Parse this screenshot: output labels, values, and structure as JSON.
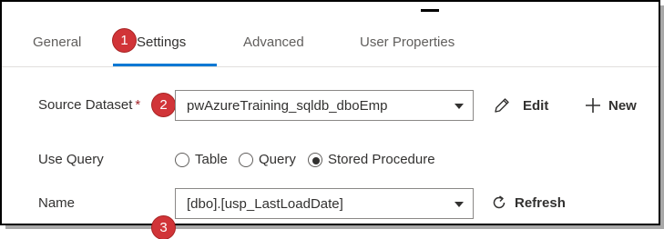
{
  "tabs": [
    {
      "label": "General"
    },
    {
      "label": "Settings"
    },
    {
      "label": "Advanced"
    },
    {
      "label": "User Properties"
    }
  ],
  "badges": [
    "1",
    "2",
    "3"
  ],
  "source_dataset": {
    "label": "Source Dataset",
    "required_marker": "*",
    "value": "pwAzureTraining_sqldb_dboEmp",
    "edit_label": "Edit",
    "new_label": "New"
  },
  "use_query": {
    "label": "Use Query",
    "options": [
      "Table",
      "Query",
      "Stored Procedure"
    ],
    "selected": "Stored Procedure"
  },
  "name_field": {
    "label": "Name",
    "value": "[dbo].[usp_LastLoadDate]",
    "refresh_label": "Refresh"
  },
  "colors": {
    "accent": "#0078d4",
    "badge": "#d13438",
    "required": "#a4262c"
  }
}
